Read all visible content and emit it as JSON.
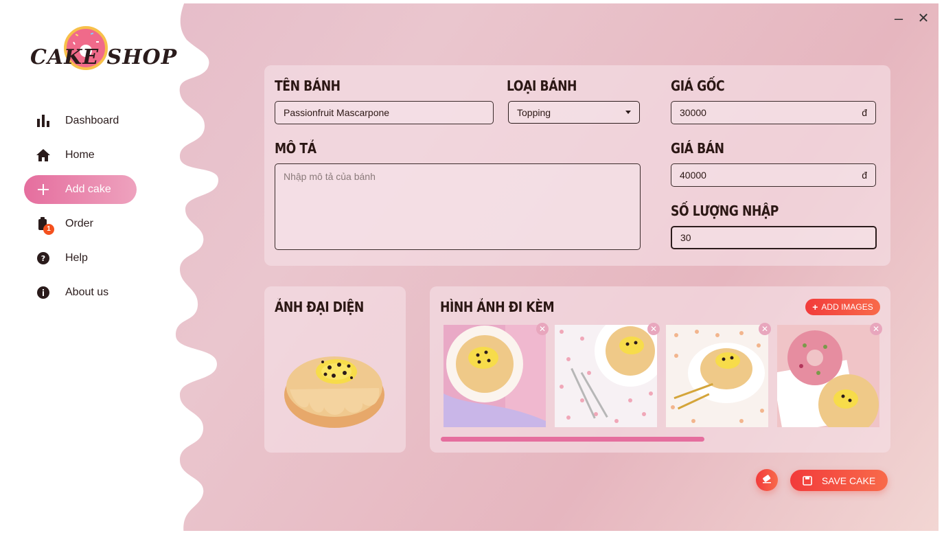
{
  "app": {
    "logo_text": "CAKE SHOP"
  },
  "window": {
    "minimize": "–",
    "close": "✕"
  },
  "sidebar": {
    "items": [
      {
        "label": "Dashboard",
        "icon": "bar-chart-icon",
        "active": false
      },
      {
        "label": "Home",
        "icon": "home-icon",
        "active": false
      },
      {
        "label": "Add cake",
        "icon": "plus-icon",
        "active": true
      },
      {
        "label": "Order",
        "icon": "order-icon",
        "active": false,
        "badge": "1"
      },
      {
        "label": "Help",
        "icon": "help-icon",
        "active": false
      },
      {
        "label": "About us",
        "icon": "info-icon",
        "active": false
      }
    ]
  },
  "form": {
    "name_label": "TÊN BÁNH",
    "name_value": "Passionfruit Mascarpone",
    "type_label": "LOẠI BÁNH",
    "type_value": "Topping",
    "cost_label": "GIÁ GỐC",
    "cost_value": "30000",
    "currency": "đ",
    "desc_label": "MÔ TẢ",
    "desc_placeholder": "Nhập mô tả của bánh",
    "price_label": "GIÁ BÁN",
    "price_value": "40000",
    "qty_label": "SỐ LƯỢNG NHẬP",
    "qty_value": "30"
  },
  "avatar_section": {
    "title": "ẢNH ĐẠI DIỆN"
  },
  "gallery": {
    "title": "HÌNH ẢNH ĐI KÈM",
    "add_label": "ADD IMAGES",
    "scroll_fraction": 0.6
  },
  "actions": {
    "save_label": "SAVE CAKE"
  },
  "colors": {
    "accent_pink": "#e56e9e",
    "action_red": "#f23b3b"
  }
}
